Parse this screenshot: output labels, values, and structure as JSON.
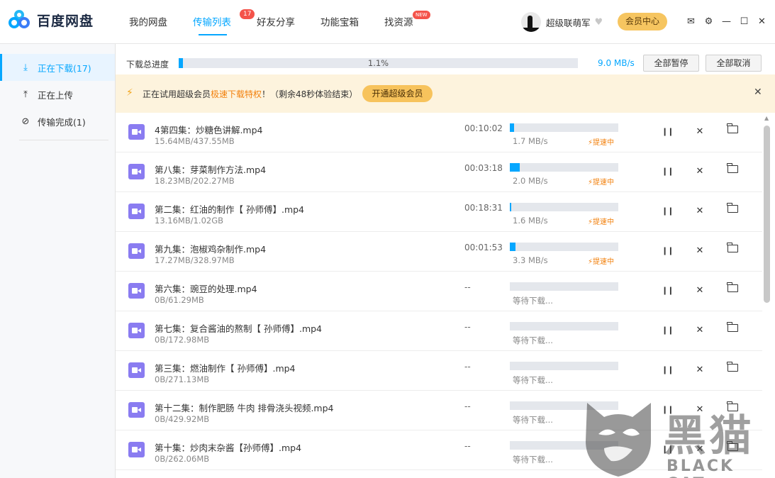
{
  "app": {
    "title": "百度网盘"
  },
  "nav": {
    "tabs": [
      {
        "label": "我的网盘"
      },
      {
        "label": "传输列表",
        "badge": "17",
        "active": true
      },
      {
        "label": "好友分享"
      },
      {
        "label": "功能宝箱"
      },
      {
        "label": "找资源",
        "badge": "NEW"
      }
    ]
  },
  "user": {
    "name": "超级联萌军",
    "vip_button": "会员中心"
  },
  "window_icons": [
    "mail-icon",
    "settings-icon",
    "minimize-icon",
    "maximize-icon",
    "close-icon"
  ],
  "sidebar": {
    "items": [
      {
        "label": "正在下载(17)",
        "icon": "download-icon",
        "active": true
      },
      {
        "label": "正在上传",
        "icon": "upload-icon"
      },
      {
        "label": "传输完成(1)",
        "icon": "check-circle-icon"
      }
    ]
  },
  "progress": {
    "label": "下载总进度",
    "percent_text": "1.1%",
    "percent": 1.1,
    "speed": "9.0 MB/s",
    "pause_all": "全部暂停",
    "cancel_all": "全部取消"
  },
  "promo": {
    "text_before": "正在试用超级会员",
    "text_highlight": "极速下载特权",
    "text_after": "！（剩余48秒体验结束）",
    "button": "开通超级会员"
  },
  "files": [
    {
      "name": "4第四集：炒糖色讲解.mp4",
      "size": "15.64MB/437.55MB",
      "time": "00:10:02",
      "progress": 0.036,
      "speed": "1.7 MB/s",
      "boost": "提速中"
    },
    {
      "name": "第八集：芽菜制作方法.mp4",
      "size": "18.23MB/202.27MB",
      "time": "00:03:18",
      "progress": 0.09,
      "speed": "2.0 MB/s",
      "boost": "提速中"
    },
    {
      "name": "第二集：红油的制作【 孙师傅】.mp4",
      "size": "13.16MB/1.02GB",
      "time": "00:18:31",
      "progress": 0.013,
      "speed": "1.6 MB/s",
      "boost": "提速中"
    },
    {
      "name": "第九集：泡椒鸡杂制作.mp4",
      "size": "17.27MB/328.97MB",
      "time": "00:01:53",
      "progress": 0.052,
      "speed": "3.3 MB/s",
      "boost": "提速中"
    },
    {
      "name": "第六集：豌豆的处理.mp4",
      "size": "0B/61.29MB",
      "time": "--",
      "progress": 0,
      "speed": "等待下载...",
      "boost": ""
    },
    {
      "name": "第七集：复合酱油的熬制【 孙师傅】.mp4",
      "size": "0B/172.98MB",
      "time": "--",
      "progress": 0,
      "speed": "等待下载...",
      "boost": ""
    },
    {
      "name": "第三集：燃油制作【 孙师傅】.mp4",
      "size": "0B/271.13MB",
      "time": "--",
      "progress": 0,
      "speed": "等待下载...",
      "boost": ""
    },
    {
      "name": "第十二集：制作肥肠 牛肉 排骨浇头视频.mp4",
      "size": "0B/429.92MB",
      "time": "--",
      "progress": 0,
      "speed": "等待下载...",
      "boost": ""
    },
    {
      "name": "第十集：炒肉末杂酱【孙师傅】.mp4",
      "size": "0B/262.06MB",
      "time": "--",
      "progress": 0,
      "speed": "等待下载...",
      "boost": ""
    }
  ],
  "watermark": {
    "title": "黑猫",
    "sub": "BLACK CAT"
  }
}
